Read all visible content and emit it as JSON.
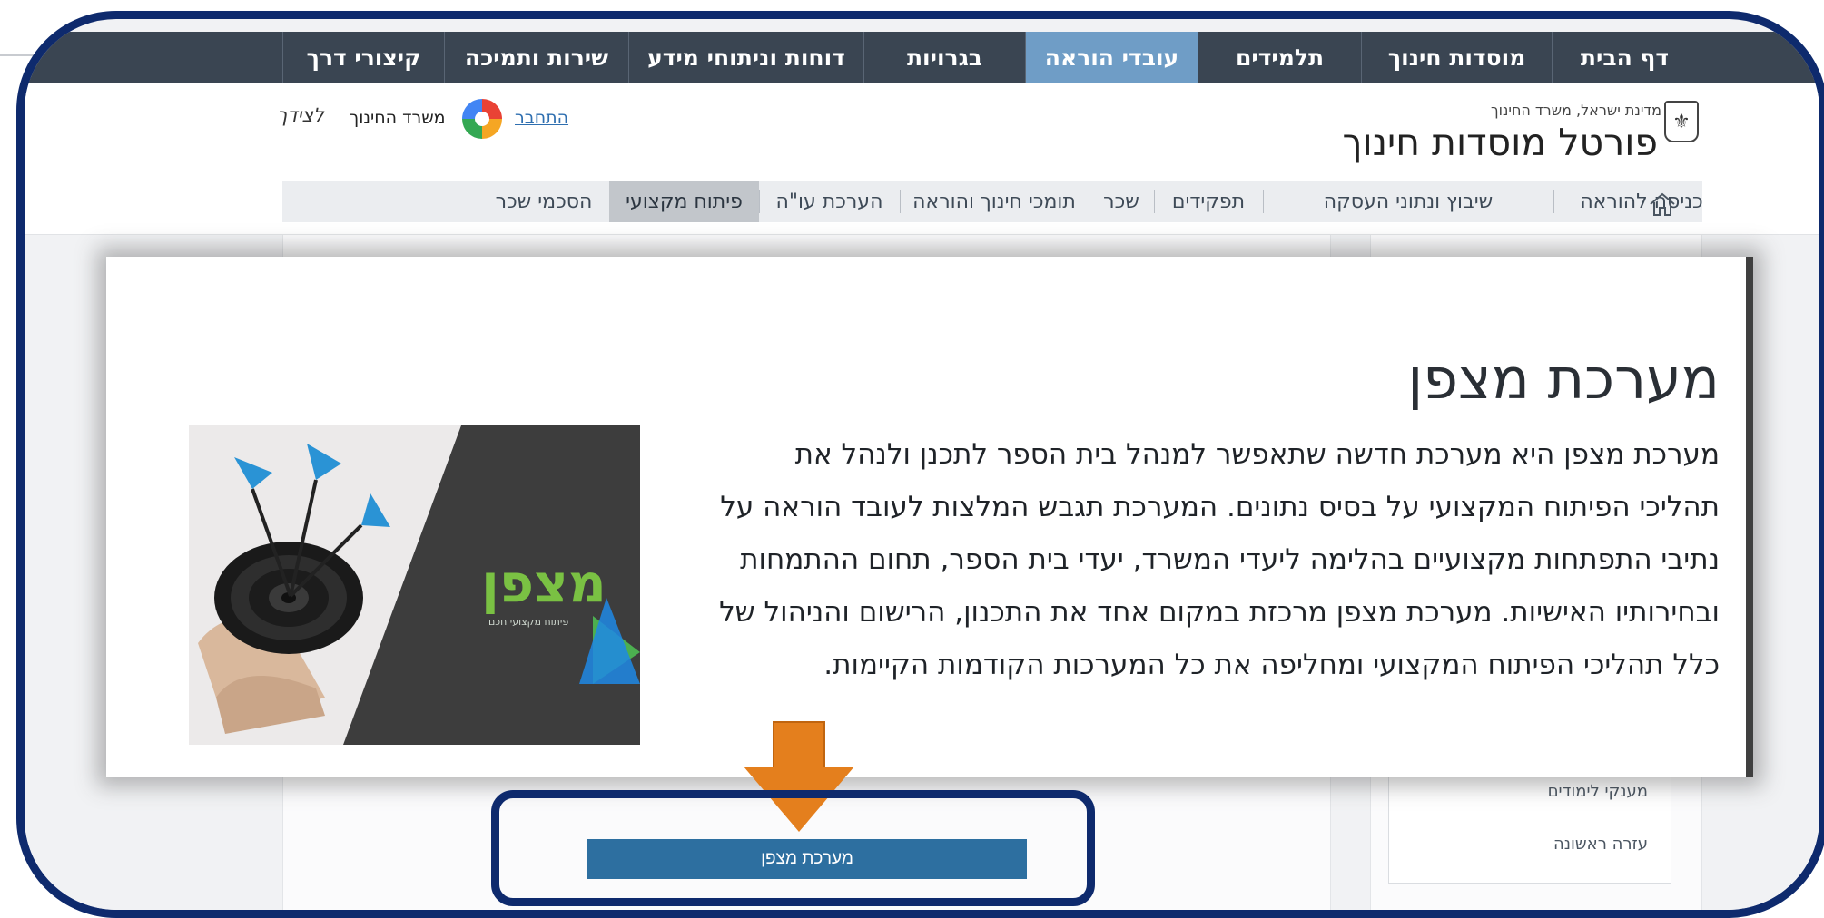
{
  "top_nav": [
    {
      "label": "דף הבית",
      "active": false
    },
    {
      "label": "מוסדות חינוך",
      "active": false
    },
    {
      "label": "תלמידים",
      "active": false
    },
    {
      "label": "עובדי הוראה",
      "active": true
    },
    {
      "label": "בגרויות",
      "active": false
    },
    {
      "label": "דוחות וניתוחי מידע",
      "active": false
    },
    {
      "label": "שירות ותמיכה",
      "active": false
    },
    {
      "label": "קיצורי דרך",
      "active": false
    }
  ],
  "header": {
    "state_line": "מדינת ישראל, משרד החינוך",
    "portal_title": "פורטל מוסדות חינוך",
    "login_link": "התחבר",
    "ministry_name": "משרד החינוך",
    "ministry_tagline": "לצידך"
  },
  "sub_nav": [
    {
      "label": "כניסה להוראה",
      "active": false
    },
    {
      "label": "שיבוץ ונתוני העסקה",
      "active": false
    },
    {
      "label": "תפקידים",
      "active": false
    },
    {
      "label": "שכר",
      "active": false
    },
    {
      "label": "תומכי חינוך והוראה",
      "active": false
    },
    {
      "label": "הערכת עו\"ה",
      "active": false
    },
    {
      "label": "פיתוח מקצועי",
      "active": true
    },
    {
      "label": "הסכמי שכר",
      "active": false
    }
  ],
  "card": {
    "title": "מערכת מצפן",
    "paragraph": "מערכת מצפן היא מערכת חדשה שתאפשר למנהל בית הספר לתכנן ולנהל את תהליכי הפיתוח המקצועי על בסיס נתונים. המערכת תגבש המלצות לעובד הוראה על נתיבי התפתחות מקצועיים בהלימה ליעדי המשרד, יעדי בית הספר, תחום ההתמחות ובחירותיו האישיות. מערכת מצפן מרכזת במקום אחד את התכנון, הרישום והניהול של כלל תהליכי הפיתוח המקצועי ומחליפה את כל המערכות הקודמות הקיימות.",
    "image_logo_text": "מצפן",
    "image_logo_sub": "פיתוח מקצועי חכם"
  },
  "sidebar": {
    "links": [
      "מענקי לימודים",
      "עזרה ראשונה"
    ],
    "cut_text": "הסכמי שכר"
  },
  "cta_button": "מערכת מצפן",
  "colors": {
    "nav_bg": "#3a4552",
    "nav_active": "#6f9dc6",
    "frame": "#0e2a6d",
    "arrow": "#e47f1d",
    "button": "#2d6fa0"
  }
}
